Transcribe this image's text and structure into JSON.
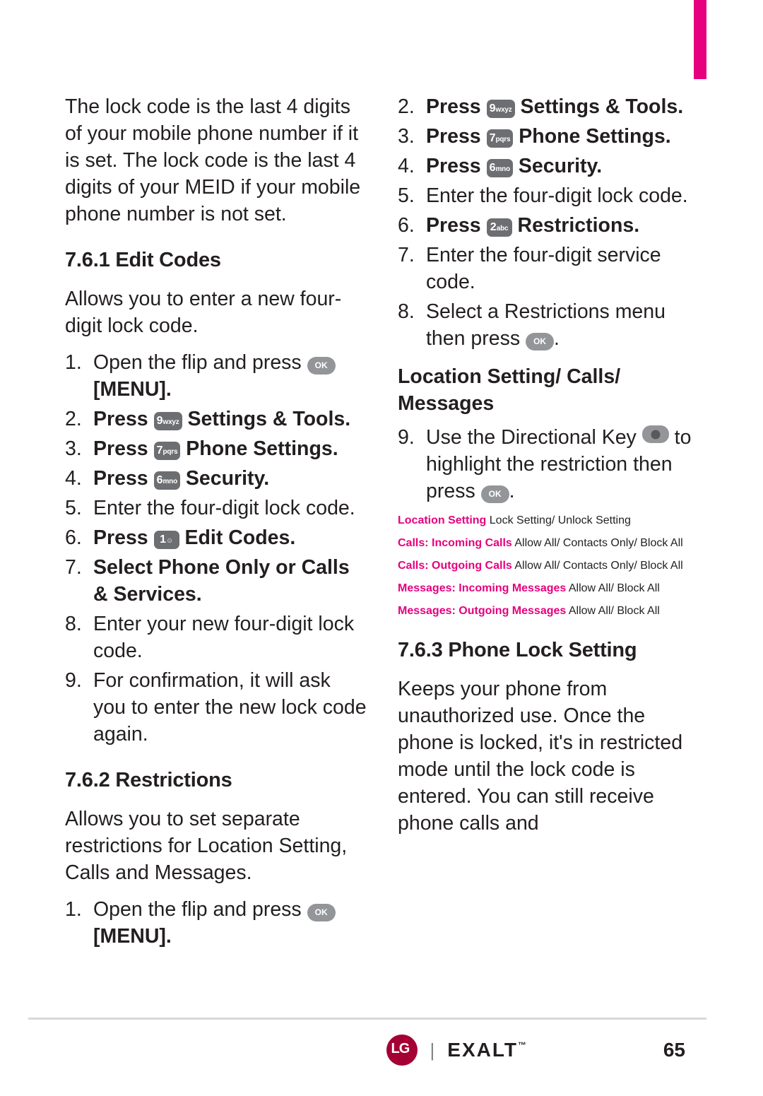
{
  "page": {
    "number": "65",
    "brand": "LG",
    "model": "EXALT",
    "tm": "™"
  },
  "left_column": {
    "intro": "The lock code is the last 4 digits of your mobile phone number if it is set. The lock code is the last 4 digits of your MEID if your mobile phone number is not set.",
    "section_761": {
      "heading": "7.6.1 Edit Codes",
      "intro": "Allows you to enter a new four-digit lock code.",
      "steps": [
        {
          "num": "1.",
          "pre": "Open the flip and press ",
          "key": "ok",
          "post": " [MENU]."
        },
        {
          "num": "2.",
          "pre": "Press ",
          "key": "9",
          "key_letters": "wxyz",
          "post": " Settings & Tools.",
          "bold_post": true
        },
        {
          "num": "3.",
          "pre": "Press ",
          "key": "7",
          "key_letters": "pqrs",
          "post": " Phone Settings.",
          "bold_post": true
        },
        {
          "num": "4.",
          "pre": "Press ",
          "key": "6",
          "key_letters": "mno",
          "post": " Security.",
          "bold_post": true
        },
        {
          "num": "5.",
          "pre": "Enter the four-digit lock code."
        },
        {
          "num": "6.",
          "pre": "Press ",
          "key": "1",
          "key_letters": "☺",
          "post": " Edit Codes.",
          "bold_post": true
        },
        {
          "num": "7.",
          "pre": "Select Phone Only or Calls & Services.",
          "mixed": "select_phone_only"
        },
        {
          "num": "8.",
          "pre": "Enter your new four-digit lock code."
        },
        {
          "num": "9.",
          "pre": "For confirmation, it will ask you to enter the new lock code again."
        }
      ]
    },
    "section_762": {
      "heading": "7.6.2 Restrictions",
      "intro": "Allows you to set separate restrictions for Location Setting, Calls and Messages.",
      "steps": [
        {
          "num": "1.",
          "pre": "Open the flip and press ",
          "key": "ok",
          "post": " [MENU]."
        }
      ]
    }
  },
  "right_column": {
    "steps": [
      {
        "num": "2.",
        "pre": "Press ",
        "key": "9",
        "key_letters": "wxyz",
        "post": " Settings & Tools.",
        "bold_post": true
      },
      {
        "num": "3.",
        "pre": "Press ",
        "key": "7",
        "key_letters": "pqrs",
        "post": " Phone Settings.",
        "bold_post": true
      },
      {
        "num": "4.",
        "pre": "Press ",
        "key": "6",
        "key_letters": "mno",
        "post": " Security.",
        "bold_post": true
      },
      {
        "num": "5.",
        "pre": "Enter the four-digit lock code."
      },
      {
        "num": "6.",
        "pre": "Press ",
        "key": "2",
        "key_letters": "abc",
        "post": " Restrictions.",
        "bold_post": true
      },
      {
        "num": "7.",
        "pre": "Enter the four-digit service code."
      },
      {
        "num": "8.",
        "pre": "Select a Restrictions menu then press ",
        "key": "ok",
        "post": "."
      }
    ],
    "subheading": "Location Setting/ Calls/ Messages",
    "step9": {
      "num": "9.",
      "pre": "Use the Directional Key ",
      "key": "dir",
      "post": " to highlight the restriction then press ",
      "key2": "ok",
      "post2": "."
    },
    "options": [
      {
        "label": "Location Setting",
        "values": "Lock Setting/ Unlock Setting"
      },
      {
        "label": "Calls: Incoming Calls",
        "values": "Allow All/ Contacts Only/ Block All"
      },
      {
        "label": "Calls: Outgoing Calls",
        "values": "Allow All/ Contacts Only/ Block All"
      },
      {
        "label": "Messages: Incoming Messages",
        "values": "Allow All/ Block All"
      },
      {
        "label": "Messages: Outgoing Messages",
        "values": "Allow All/ Block All"
      }
    ],
    "section_763": {
      "heading": "7.6.3 Phone Lock Setting",
      "body": "Keeps your phone from unauthorized use. Once the phone is locked, it's in restricted mode until the lock code is entered. You can still receive phone calls and"
    }
  }
}
